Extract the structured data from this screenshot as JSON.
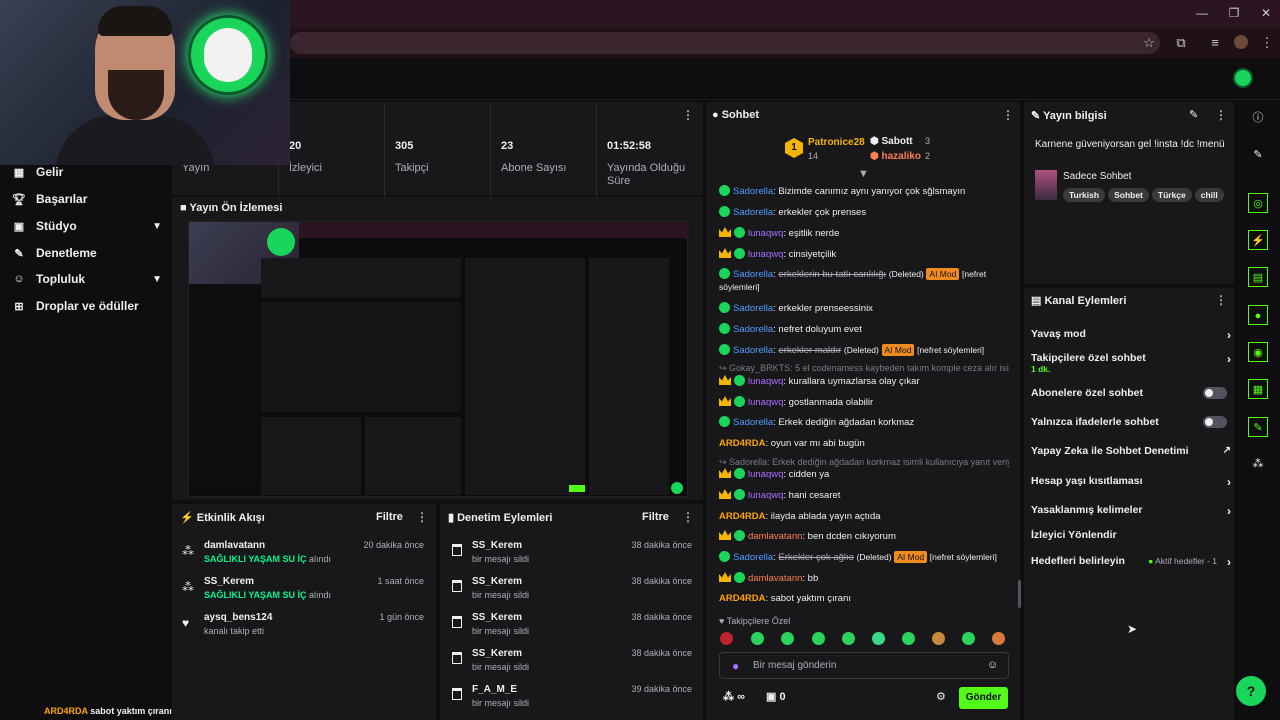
{
  "stats": [
    {
      "value": "",
      "label": "Yayın"
    },
    {
      "value": "20",
      "label": "İzleyici"
    },
    {
      "value": "305",
      "label": "Takipçi"
    },
    {
      "value": "23",
      "label": "Abone Sayısı"
    },
    {
      "value": "01:52:58",
      "label": "Yayında Olduğu Süre"
    }
  ],
  "sidebar": {
    "items": [
      {
        "label": "Gelir",
        "icon": "money-icon"
      },
      {
        "label": "Başarılar",
        "icon": "trophy-icon"
      },
      {
        "label": "Stüdyo",
        "icon": "studio-icon",
        "expandable": true
      },
      {
        "label": "Denetleme",
        "icon": "wrench-icon"
      },
      {
        "label": "Topluluk",
        "icon": "community-icon",
        "expandable": true
      },
      {
        "label": "Droplar ve ödüller",
        "icon": "drops-icon"
      }
    ]
  },
  "preview": {
    "title": "Yayın Ön İzlemesi"
  },
  "activity": {
    "title": "Etkinlik Akışı",
    "filter": "Filtre",
    "events": [
      {
        "name": "damlavatann",
        "highlight": "SAĞLIKLI YAŞAM SU İÇ",
        "suffix": "alındı",
        "time": "20 dakika önce",
        "icon": "points-icon"
      },
      {
        "name": "SS_Kerem",
        "highlight": "SAĞLIKLI YAŞAM SU İÇ",
        "suffix": "alındı",
        "time": "1 saat önce",
        "icon": "points-icon"
      },
      {
        "name": "aysq_bens124",
        "highlight": "",
        "suffix": "kanalı takip etti",
        "time": "1 gün önce",
        "icon": "heart-icon"
      }
    ]
  },
  "moderation": {
    "title": "Denetim Eylemleri",
    "filter": "Filtre",
    "actions": [
      {
        "name": "SS_Kerem",
        "desc": "bir mesajı sildi",
        "time": "38 dakika önce"
      },
      {
        "name": "SS_Kerem",
        "desc": "bir mesajı sildi",
        "time": "38 dakika önce"
      },
      {
        "name": "SS_Kerem",
        "desc": "bir mesajı sildi",
        "time": "38 dakika önce"
      },
      {
        "name": "SS_Kerem",
        "desc": "bir mesajı sildi",
        "time": "38 dakika önce"
      },
      {
        "name": "F_A_M_E",
        "desc": "bir mesajı sildi",
        "time": "39 dakika önce"
      }
    ]
  },
  "chat": {
    "title": "Sohbet",
    "leaderboard": {
      "first": {
        "rank": "1",
        "name": "Patronice28",
        "score": "14"
      },
      "second": {
        "name": "Sabott",
        "score": "3"
      },
      "third": {
        "name": "hazaliko",
        "score": "2"
      }
    },
    "messages": [
      {
        "user": "Sadorella",
        "color": "uG",
        "badge": "sub",
        "text": ": Bizimde canımız aynı yanıyor çok sğlsmayın"
      },
      {
        "user": "Sadorella",
        "color": "uG",
        "badge": "sub",
        "text": ": erkekler çok prenses"
      },
      {
        "user": "lunaqwq",
        "color": "uP",
        "badge": "crown",
        "text": ": eşitlik nerde"
      },
      {
        "user": "lunaqwq",
        "color": "uP",
        "badge": "crown",
        "text": ": cinsiyetçilik"
      },
      {
        "user": "Sadorella",
        "color": "uG",
        "badge": "sub",
        "text": ": ",
        "deleted": "erkeklerin bu tatlı canlılığı",
        "note": "(Deleted)",
        "ai": "AI Mod",
        "reason": "[nefret söylemleri]"
      },
      {
        "user": "Sadorella",
        "color": "uG",
        "badge": "sub",
        "text": ": erkekler prenseessinix"
      },
      {
        "user": "Sadorella",
        "color": "uG",
        "badge": "sub",
        "text": ": nefret doluyum evet"
      },
      {
        "user": "Sadorella",
        "color": "uG",
        "badge": "sub",
        "text": ": ",
        "deleted": "erkekler maldır",
        "note": "(Deleted)",
        "ai": "AI Mod",
        "reason": "[nefret söylemleri]"
      },
      {
        "system": "Gokay_BRKTS: 5 el codenamess kaybeden takım komple ceza alır isimli..."
      },
      {
        "user": "lunaqwq",
        "color": "uP",
        "badge": "crown",
        "text": ": kurallara uymazlarsa olay çıkar"
      },
      {
        "user": "lunaqwq",
        "color": "uP",
        "badge": "crown",
        "text": ": gostlanmada olabilir"
      },
      {
        "user": "Sadorella",
        "color": "uG",
        "badge": "sub",
        "text": ": Erkek dediğin ağdadan korkmaz"
      },
      {
        "user": "ARD4RDA",
        "color": "uY",
        "badge": "",
        "text": ": oyun var mı abi bugün"
      },
      {
        "system": "Sadorella: Erkek dediğin ağdadan korkmaz isimli kullanıcıya yanıt veriy..."
      },
      {
        "user": "lunaqwq",
        "color": "uP",
        "badge": "crown",
        "text": ": cidden ya"
      },
      {
        "user": "lunaqwq",
        "color": "uP",
        "badge": "crown",
        "text": ": hani cesaret"
      },
      {
        "user": "ARD4RDA",
        "color": "uY",
        "badge": "",
        "text": ": ilayda ablada yayın açtıda"
      },
      {
        "user": "damlavatann",
        "color": "uO",
        "badge": "crown",
        "text": ": ben dcden cıkıyorum"
      },
      {
        "user": "Sadorella",
        "color": "uG",
        "badge": "sub",
        "text": ": ",
        "deleted": "Erkekler çok ağlıo",
        "note": "(Deleted)",
        "ai": "AI Mod",
        "reason": "[nefret söylemleri]"
      },
      {
        "user": "damlavatann",
        "color": "uO",
        "badge": "crown",
        "text": ": bb"
      },
      {
        "user": "ARD4RDA",
        "color": "uY",
        "badge": "",
        "text": ": sabot yaktım çıranı"
      }
    ],
    "emote_label": "Takipçilere Özel",
    "input_placeholder": "Bir mesaj gönderin",
    "points": "∞",
    "gifts": "0",
    "send": "Gönder"
  },
  "stream_info": {
    "title": "Yayın bilgisi",
    "stream_title": "Karnene güveniyorsan gel !insta !dc !menü",
    "category": "Sadece Sohbet",
    "tags": [
      "Turkish",
      "Sohbet",
      "Türkçe",
      "chill"
    ]
  },
  "channel_actions": {
    "title": "Kanal Eylemleri",
    "items": [
      {
        "label": "Yavaş mod",
        "kind": "arrow"
      },
      {
        "label": "Takipçilere özel sohbet",
        "sub": "1 dk.",
        "kind": "arrow"
      },
      {
        "label": "Abonelere özel sohbet",
        "kind": "toggle"
      },
      {
        "label": "Yalnızca ifadelerle sohbet",
        "kind": "toggle"
      },
      {
        "label": "Yapay Zeka ile Sohbet Denetimi",
        "kind": "external"
      },
      {
        "label": "Hesap yaşı kısıtlaması",
        "kind": "arrow"
      },
      {
        "label": "Yasaklanmış kelimeler",
        "kind": "arrow"
      },
      {
        "label": "İzleyici Yönlendir",
        "kind": "none"
      },
      {
        "label": "Hedefleri belirleyin",
        "kind": "arrow",
        "extra": "Aktif hedefler - 1"
      }
    ]
  },
  "overlay_chat": {
    "user": "ARD4RDA",
    "text": "sabot yaktım çıranı"
  },
  "colors": {
    "accent": "#53fc18",
    "bg": "#0e0e10",
    "panel": "#18181b"
  }
}
